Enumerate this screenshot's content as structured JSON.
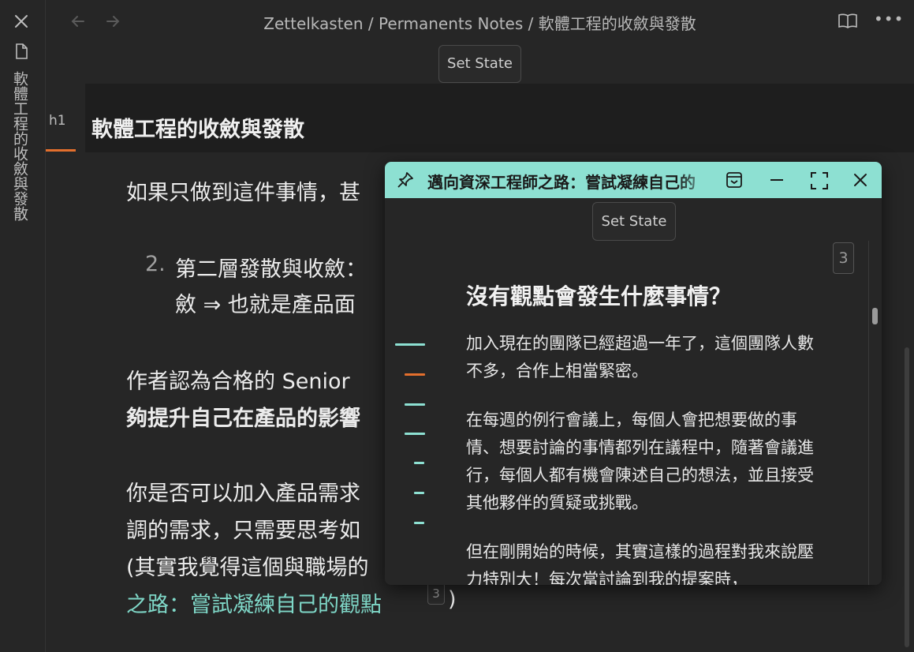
{
  "sidebar": {
    "vertical_title": "軟體工程的收斂與發散"
  },
  "topbar": {
    "breadcrumb": "Zettelkasten / Permanents Notes / 軟體工程的收斂與發散"
  },
  "main": {
    "set_state_label": "Set State",
    "heading_level": "h1",
    "heading": "軟體工程的收斂與發散",
    "para1": "如果只做到這件事情，甚",
    "list_marker": "2.",
    "list_line1": "第二層發散與收斂：",
    "list_line2": "斂 ⇒ 也就是產品面",
    "para2_line1": "作者認為合格的 Senior",
    "para2_line2": "夠提升自己在產品的影響",
    "para3_line1": "你是否可以加入產品需求",
    "para3_line2": "調的需求，只需要思考如",
    "para3_line3": "(其實我覺得這個與職場的",
    "para3_link": "之路：嘗試凝練自己的觀點",
    "footnote": "3",
    "close_paren": ")"
  },
  "popover": {
    "title": "邁向資深工程師之路：嘗試凝練自己的觀點",
    "set_state_label": "Set State",
    "footnote": "3",
    "heading": "沒有觀點會發生什麼事情？",
    "p1": "加入現在的團隊已經超過一年了，這個團隊人數不多，合作上相當緊密。",
    "p2": "在每週的例行會議上，每個人會把想要做的事情、想要討論的事情都列在議程中，隨著會議進行，每個人都有機會陳述自己的想法，並且接受其他夥伴的質疑或挑戰。",
    "p3": "但在剛開始的時候，其實這樣的過程對我來說壓力特別大！每次當討論到我的提案時，"
  },
  "colors": {
    "accent": "#e36f2d",
    "teal": "#8de0d2",
    "link": "#7fd8c8",
    "background": "#262626"
  },
  "icons": [
    "close-icon",
    "file-icon",
    "back-arrow-icon",
    "forward-arrow-icon",
    "reading-mode-icon",
    "more-options-icon",
    "pin-icon",
    "collapse-icon",
    "minimize-icon",
    "maximize-icon",
    "close-popover-icon"
  ]
}
